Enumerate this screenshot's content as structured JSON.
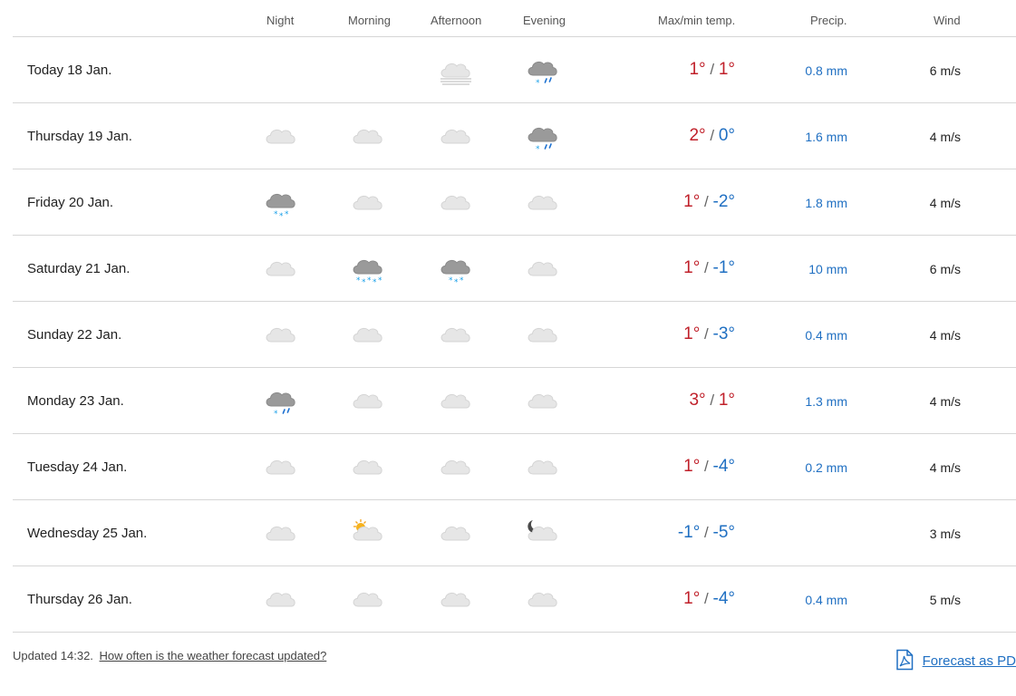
{
  "header": {
    "night": "Night",
    "morning": "Morning",
    "afternoon": "Afternoon",
    "evening": "Evening",
    "temp": "Max/min temp.",
    "precip": "Precip.",
    "wind": "Wind"
  },
  "colors": {
    "warm": "#c0202a",
    "cold": "#1f6fc2",
    "link": "#1f6fc2",
    "divider": "#d6d6d6"
  },
  "rows": [
    {
      "day": "Today 18 Jan.",
      "icons": [
        "",
        "",
        "fog-cloud-icon",
        "sleet-cloud-icon"
      ],
      "max": "1°",
      "min": "1°",
      "max_class": "warm",
      "min_class": "warm",
      "precip": "0.8 mm",
      "wind": "6 m/s"
    },
    {
      "day": "Thursday 19 Jan.",
      "icons": [
        "cloud-icon",
        "cloud-icon",
        "cloud-icon",
        "sleet-cloud-icon"
      ],
      "max": "2°",
      "min": "0°",
      "max_class": "warm",
      "min_class": "cold",
      "precip": "1.6 mm",
      "wind": "4 m/s"
    },
    {
      "day": "Friday 20 Jan.",
      "icons": [
        "snow-cloud-icon",
        "cloud-icon",
        "cloud-icon",
        "cloud-icon"
      ],
      "max": "1°",
      "min": "-2°",
      "max_class": "warm",
      "min_class": "cold",
      "precip": "1.8 mm",
      "wind": "4 m/s"
    },
    {
      "day": "Saturday 21 Jan.",
      "icons": [
        "cloud-icon",
        "heavy-snow-cloud-icon",
        "snow-cloud-icon",
        "cloud-icon"
      ],
      "max": "1°",
      "min": "-1°",
      "max_class": "warm",
      "min_class": "cold",
      "precip": "10 mm",
      "wind": "6 m/s"
    },
    {
      "day": "Sunday 22 Jan.",
      "icons": [
        "cloud-icon",
        "cloud-icon",
        "cloud-icon",
        "cloud-icon"
      ],
      "max": "1°",
      "min": "-3°",
      "max_class": "warm",
      "min_class": "cold",
      "precip": "0.4 mm",
      "wind": "4 m/s"
    },
    {
      "day": "Monday 23 Jan.",
      "icons": [
        "sleet-cloud-icon",
        "cloud-icon",
        "cloud-icon",
        "cloud-icon"
      ],
      "max": "3°",
      "min": "1°",
      "max_class": "warm",
      "min_class": "warm",
      "precip": "1.3 mm",
      "wind": "4 m/s"
    },
    {
      "day": "Tuesday 24 Jan.",
      "icons": [
        "cloud-icon",
        "cloud-icon",
        "cloud-icon",
        "cloud-icon"
      ],
      "max": "1°",
      "min": "-4°",
      "max_class": "warm",
      "min_class": "cold",
      "precip": "0.2 mm",
      "wind": "4 m/s"
    },
    {
      "day": "Wednesday 25 Jan.",
      "icons": [
        "cloud-icon",
        "sun-cloud-icon",
        "cloud-icon",
        "moon-cloud-icon"
      ],
      "max": "-1°",
      "min": "-5°",
      "max_class": "cold",
      "min_class": "cold",
      "precip": "",
      "wind": "3 m/s"
    },
    {
      "day": "Thursday 26 Jan.",
      "icons": [
        "cloud-icon",
        "cloud-icon",
        "cloud-icon",
        "cloud-icon"
      ],
      "max": "1°",
      "min": "-4°",
      "max_class": "warm",
      "min_class": "cold",
      "precip": "0.4 mm",
      "wind": "5 m/s"
    }
  ],
  "footer": {
    "updated": "Updated 14:32.",
    "help_link": "How often is the weather forecast updated?",
    "pdf_icon": "pdf-icon",
    "pdf_label": "Forecast as PD"
  }
}
